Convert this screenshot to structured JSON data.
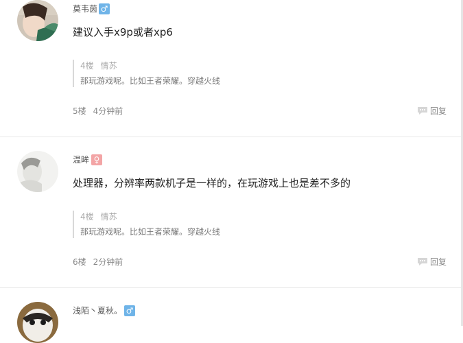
{
  "posts": [
    {
      "username": "莫韦茵",
      "gender_icon": "male-icon",
      "gender_glyph": "♂",
      "content": "建议入手x9p或者xp6",
      "quote": {
        "floor": "4楼",
        "user": "情苏",
        "text": "那玩游戏呢。比如王者荣耀。穿越火线"
      },
      "floor": "5楼",
      "time": "4分钟前",
      "reply_label": "回复"
    },
    {
      "username": "温眸",
      "gender_icon": "female-icon",
      "gender_glyph": "♀",
      "content": "处理器，分辨率两款机子是一样的，在玩游戏上也是差不多的",
      "quote": {
        "floor": "4楼",
        "user": "情苏",
        "text": "那玩游戏呢。比如王者荣耀。穿越火线"
      },
      "floor": "6楼",
      "time": "2分钟前",
      "reply_label": "回复"
    },
    {
      "username": "浅陌丶夏秋。",
      "gender_icon": "male-icon",
      "gender_glyph": "♂"
    }
  ],
  "colors": {
    "male_badge": "#6fb4e8",
    "female_badge": "#f3a5a6",
    "divider": "#e8e8e8"
  }
}
